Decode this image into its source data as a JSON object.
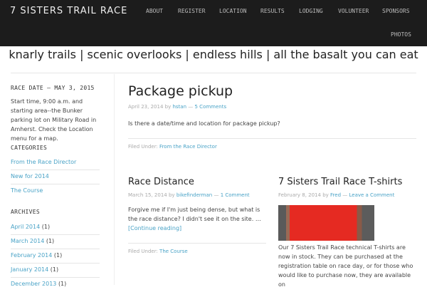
{
  "header": {
    "site_title": "7 SISTERS TRAIL RACE",
    "nav": [
      "ABOUT",
      "REGISTER",
      "LOCATION",
      "RESULTS",
      "LODGING",
      "VOLUNTEER",
      "SPONSORS",
      "PHOTOS"
    ]
  },
  "tagline": "knarly trails | scenic overlooks | endless hills | all the basalt you can eat",
  "sidebar": {
    "race_date_title": "RACE DATE – MAY 3, 2015",
    "race_date_text": "Start time, 9:00 a.m. and starting area--the Bunker parking lot on Military Road in Amherst. Check the Location menu for a map.",
    "categories_title": "CATEGORIES",
    "categories": [
      "From the Race Director",
      "New for 2014",
      "The Course"
    ],
    "archives_title": "ARCHIVES",
    "archives": [
      {
        "label": "April 2014",
        "count": "(1)"
      },
      {
        "label": "March 2014",
        "count": "(1)"
      },
      {
        "label": "February 2014",
        "count": "(1)"
      },
      {
        "label": "January 2014",
        "count": "(1)"
      },
      {
        "label": "December 2013",
        "count": "(1)"
      }
    ]
  },
  "posts": [
    {
      "title": "Package pickup",
      "date": "April 23, 2014",
      "by": "by",
      "author": "hstan",
      "sep": "—",
      "comments": "5 Comments",
      "text": "Is there a date/time and location for package pickup?",
      "filed_label": "Filed Under:",
      "filed": "From the Race Director"
    },
    {
      "title": "Race Distance",
      "date": "March 15, 2014",
      "by": "by",
      "author": "bikefinderman",
      "sep": "—",
      "comments": "1 Comment",
      "text": "Forgive me if I'm just being dense, but what is the race distance?  I didn't see it on the site. …",
      "more": "[Continue reading]",
      "filed_label": "Filed Under:",
      "filed": "The Course"
    },
    {
      "title": "7 Sisters Trail Race T-shirts",
      "date": "February 8, 2014",
      "by": "by",
      "author": "Fred",
      "sep": "—",
      "comments": "Leave a Comment",
      "text": "Our 7 Sisters Trail Race technical T-shirts are now in stock. They can be purchased at the registration table on race day, or for those who would like to purchase now, they are available on"
    }
  ]
}
